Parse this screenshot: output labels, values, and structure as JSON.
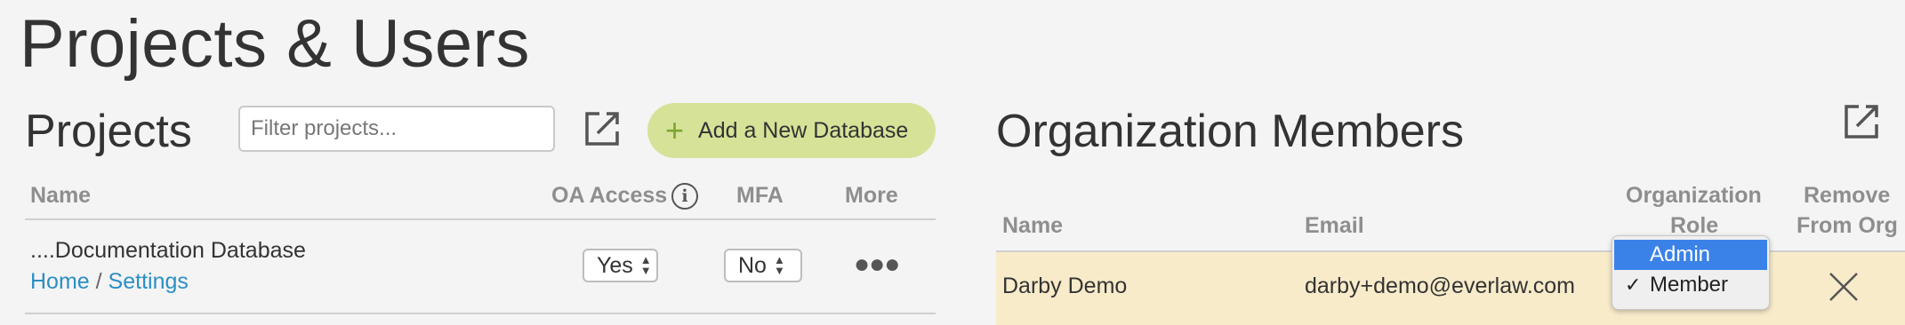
{
  "page": {
    "title": "Projects & Users"
  },
  "projects": {
    "title": "Projects",
    "filter_placeholder": "Filter projects...",
    "add_button_label": "Add a New Database",
    "columns": {
      "name": "Name",
      "oa_access": "OA Access",
      "mfa": "MFA",
      "more": "More"
    },
    "rows": [
      {
        "name": "....Documentation Database",
        "link_home": "Home",
        "separator": "/",
        "link_settings": "Settings",
        "oa_access": "Yes",
        "mfa": "No"
      }
    ]
  },
  "members": {
    "title": "Organization Members",
    "columns": {
      "name": "Name",
      "email": "Email",
      "role_line1": "Organization",
      "role_line2": "Role",
      "remove_line1": "Remove",
      "remove_line2": "From Org"
    },
    "rows": [
      {
        "name": "Darby Demo",
        "email": "darby+demo@everlaw.com",
        "role": "Member"
      }
    ],
    "role_options": [
      {
        "label": "Admin",
        "highlighted": true
      },
      {
        "label": "Member",
        "checked": true
      }
    ]
  },
  "icons": {
    "external_link": "external-link-icon",
    "plus": "plus-icon",
    "info": "info-icon",
    "more": "more-dots-icon",
    "remove": "close-x-icon",
    "check": "checkmark-icon"
  },
  "colors": {
    "background": "#f4f4f4",
    "add_button": "#d6e298",
    "plus_icon": "#7da531",
    "link": "#2b8fc4",
    "row_highlight": "#f8ebca",
    "dropdown_highlight": "#3b82e8",
    "column_header": "#8e8e8e"
  }
}
